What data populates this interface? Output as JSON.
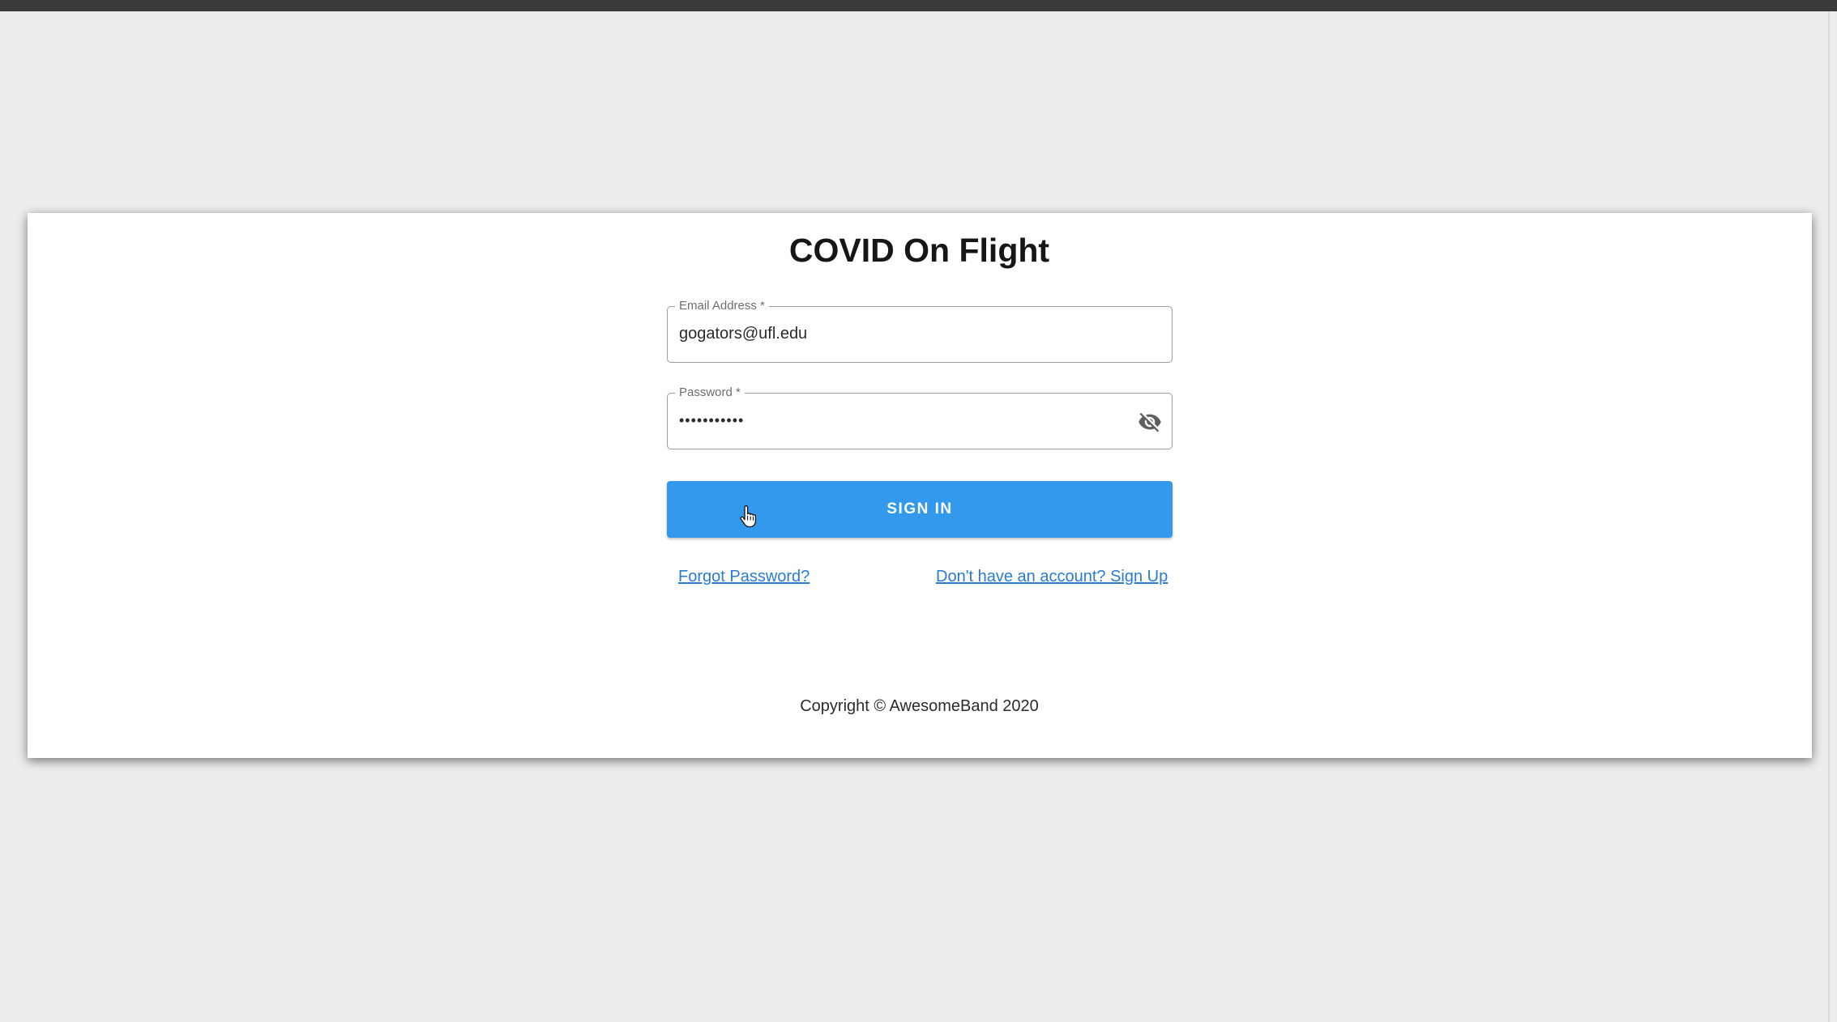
{
  "app": {
    "title": "COVID On Flight"
  },
  "form": {
    "email": {
      "label": "Email Address *",
      "value": "gogators@ufl.edu"
    },
    "password": {
      "label": "Password *",
      "value": "•••••••••••",
      "toggle_icon": "eye-off-icon"
    },
    "sign_in_label": "SIGN IN"
  },
  "links": {
    "forgot_password": "Forgot Password?",
    "sign_up": "Don't have an account? Sign Up"
  },
  "footer": {
    "copyright": "Copyright © AwesomeBand 2020"
  },
  "colors": {
    "primary": "#3399ec",
    "link": "#2a7bd2",
    "background": "#ededed",
    "top_bar": "#3a3a3a"
  }
}
